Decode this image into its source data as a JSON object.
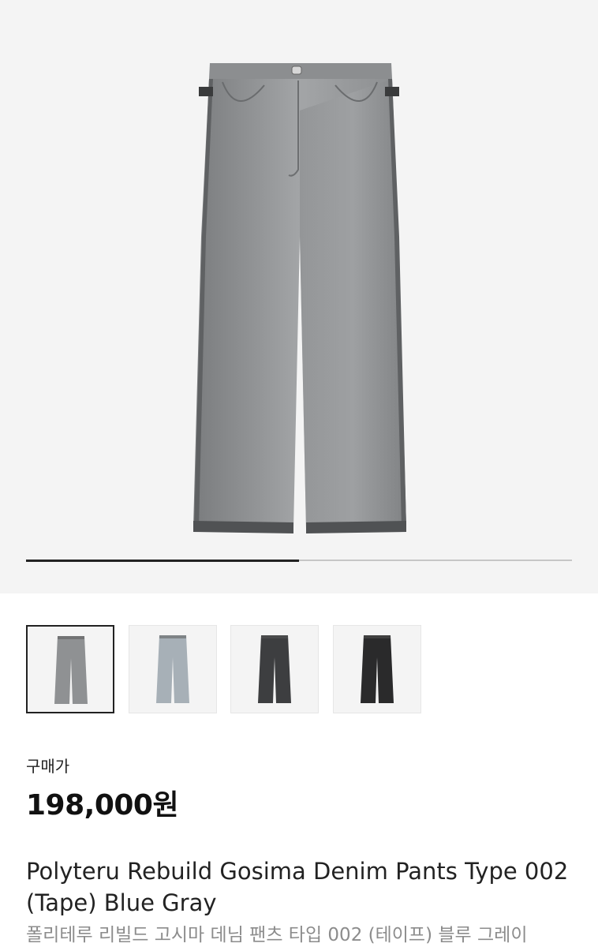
{
  "gallery": {
    "progress": 0.5,
    "main_image_icon": "pants-image",
    "thumbnails": [
      {
        "name": "blue-gray",
        "color": "#8f9193",
        "selected": true
      },
      {
        "name": "light-blue",
        "color": "#a7b0b7",
        "selected": false
      },
      {
        "name": "charcoal",
        "color": "#3d3e40",
        "selected": false
      },
      {
        "name": "black",
        "color": "#2a2a2b",
        "selected": false
      }
    ]
  },
  "price": {
    "label": "구매가",
    "value": "198,000원"
  },
  "product": {
    "title_en": "Polyteru Rebuild Gosima Denim Pants Type 002 (Tape) Blue Gray",
    "title_ko": "폴리테루 리빌드 고시마 데님 팬츠 타입 002 (테이프) 블루 그레이"
  }
}
